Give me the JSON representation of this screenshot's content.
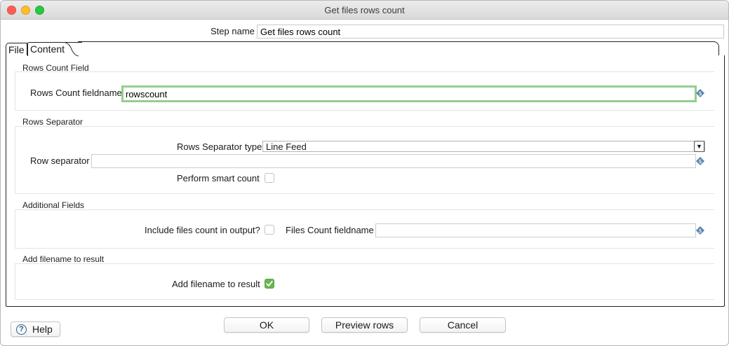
{
  "window": {
    "title": "Get files rows count"
  },
  "step": {
    "label": "Step name",
    "value": "Get files rows count"
  },
  "tabs": [
    {
      "label": "File"
    },
    {
      "label": "Content"
    }
  ],
  "rows_count_field": {
    "title": "Rows Count Field",
    "fieldname_label": "Rows Count fieldname",
    "fieldname_value": "rowscount"
  },
  "rows_separator": {
    "title": "Rows Separator",
    "type_label": "Rows Separator type",
    "type_value": "Line Feed",
    "row_separator_label": "Row separator",
    "row_separator_value": "",
    "smart_count_label": "Perform smart count",
    "smart_count_checked": false
  },
  "additional_fields": {
    "title": "Additional Fields",
    "include_label": "Include files count in output?",
    "include_checked": false,
    "files_count_label": "Files Count fieldname",
    "files_count_value": ""
  },
  "add_filename": {
    "title": "Add filename to result",
    "label": "Add filename to result",
    "checked": true
  },
  "buttons": {
    "help": "Help",
    "ok": "OK",
    "preview": "Preview rows",
    "cancel": "Cancel"
  },
  "icons": {
    "variable": "dollar-variable-icon",
    "help": "question-icon",
    "dropdown": "triangle-down-icon"
  },
  "colors": {
    "focus_border": "#93cf8c",
    "checkbox_checked": "#69b550"
  }
}
